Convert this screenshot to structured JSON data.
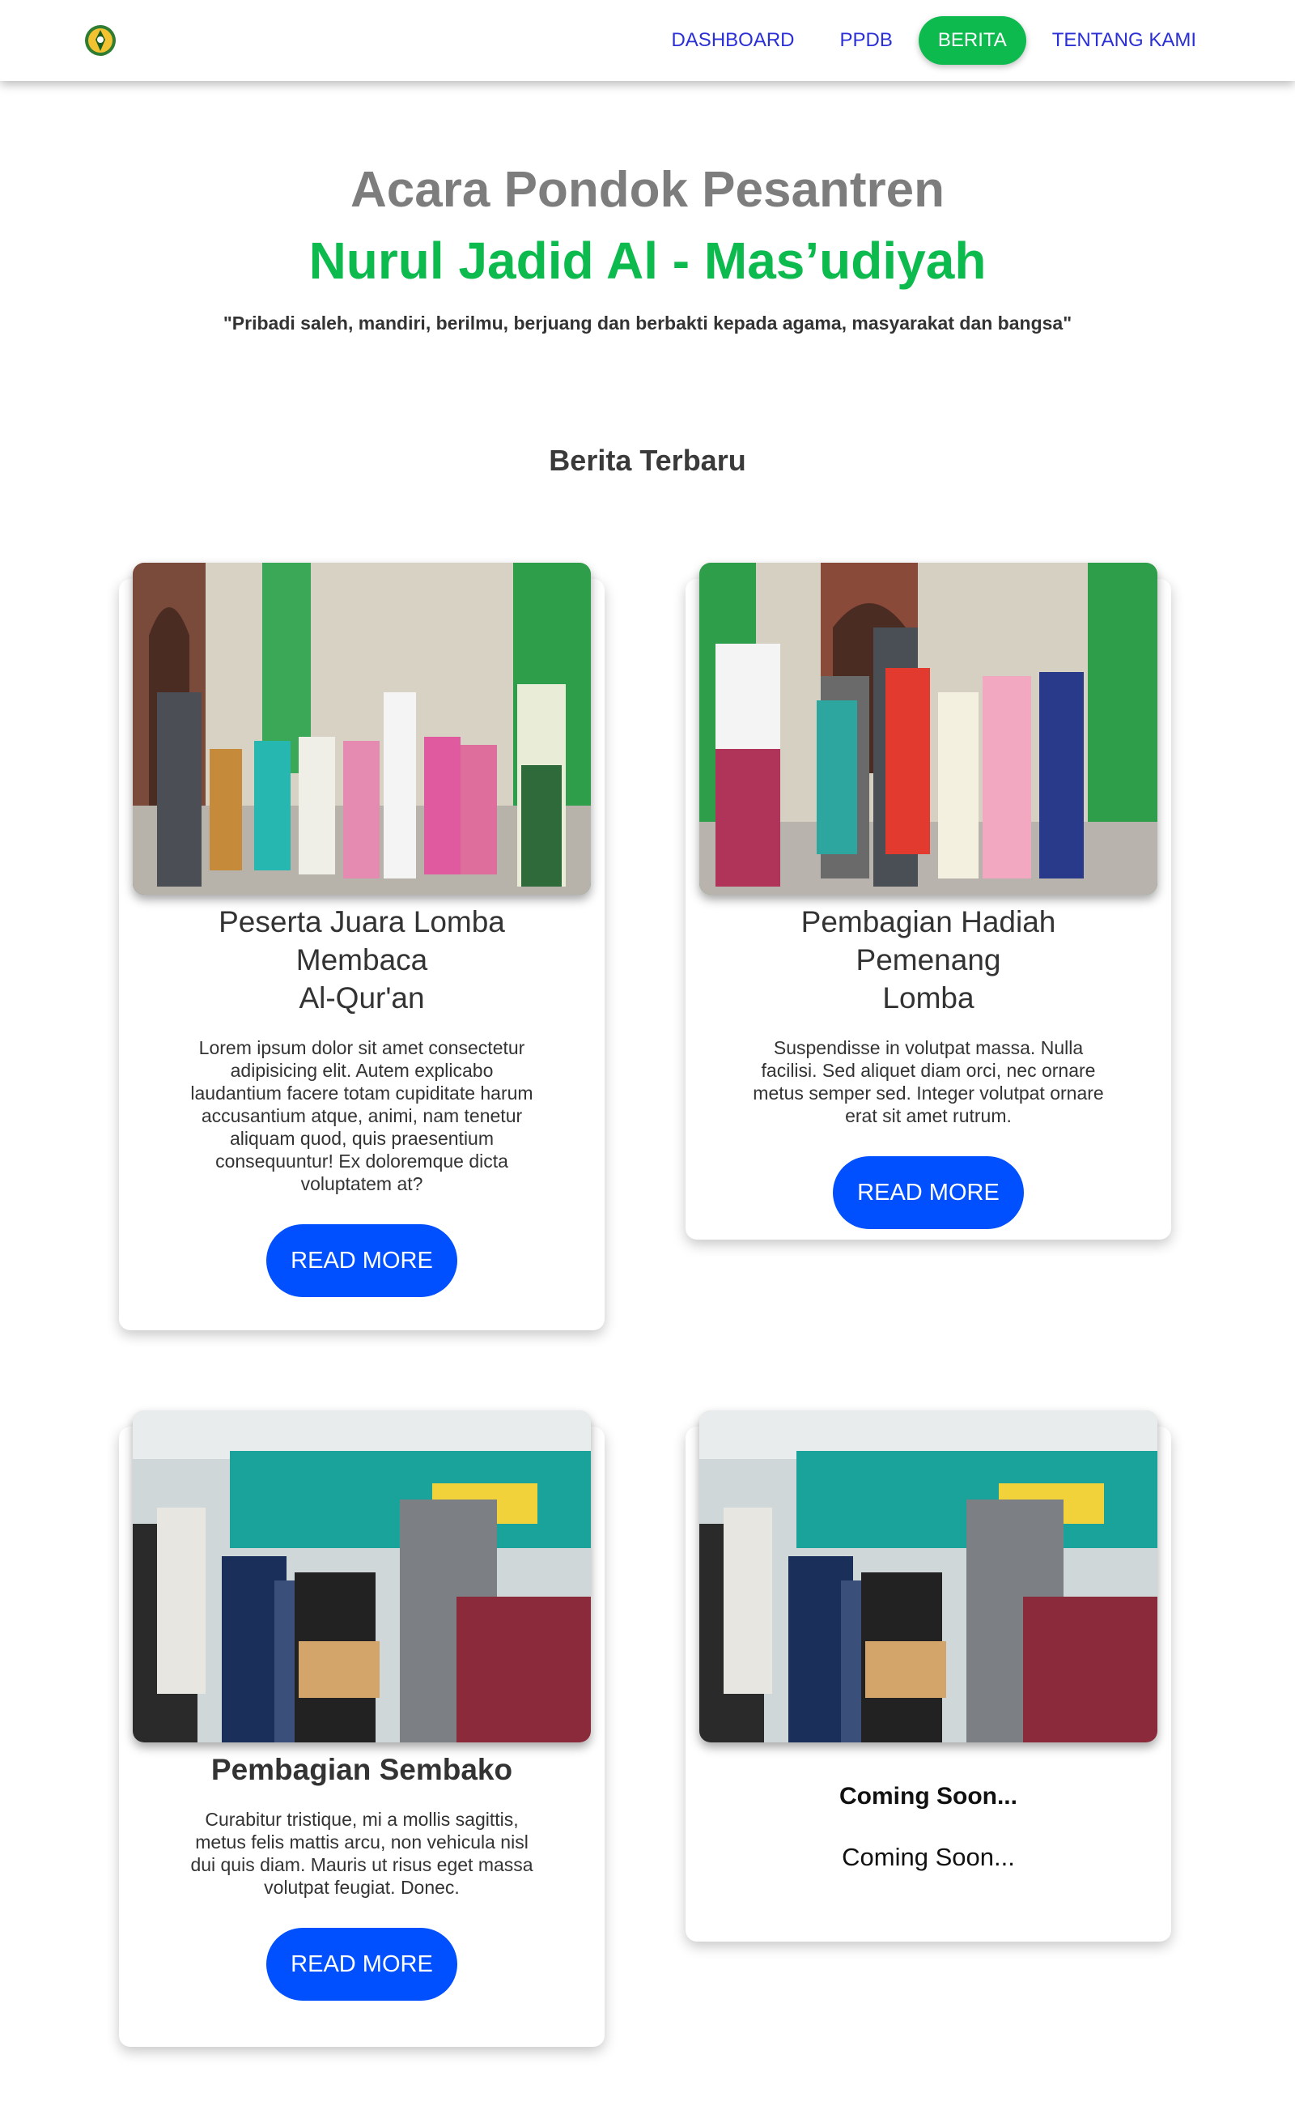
{
  "nav": {
    "items": [
      {
        "label": "DASHBOARD",
        "active": false
      },
      {
        "label": "PPDB",
        "active": false
      },
      {
        "label": "BERITA",
        "active": true
      },
      {
        "label": "TENTANG KAMI",
        "active": false
      }
    ],
    "active_color": "#0dba4d",
    "link_color": "#2b2fd6"
  },
  "hero": {
    "title_line1": "Acara Pondok Pesantren",
    "title_line2": "Nurul Jadid Al - Mas’udiyah",
    "quote": "\"Pribadi saleh, mandiri, berilmu, berjuang dan berbakti kepada agama, masyarakat dan bangsa\""
  },
  "section_title": "Berita Terbaru",
  "cards": [
    {
      "title": "Peserta Juara Lomba\nMembaca\nAl-Qur'an",
      "text": "Lorem ipsum dolor sit amet consectetur\nadipisicing elit. Autem explicabo\nlaudantium facere totam cupiditate harum\naccusantium atque, animi, nam tenetur\naliquam quod, quis praesentium\nconsequuntur! Ex doloremque dicta\nvoluptatem at?",
      "button": "READ MORE"
    },
    {
      "title": "Pembagian Hadiah Pemenang\nLomba",
      "text": "Suspendisse in volutpat massa. Nulla\nfacilisi. Sed aliquet diam orci, nec ornare\nmetus semper sed. Integer volutpat ornare\nerat sit amet rutrum.",
      "button": "READ MORE"
    },
    {
      "title": "Pembagian Sembako",
      "text": "Curabitur tristique, mi a mollis sagittis,\nmetus felis mattis arcu, non vehicula nisl\ndui quis diam. Mauris ut risus eget massa\nvolutpat feugiat. Donec.",
      "button": "READ MORE"
    },
    {
      "title": "Coming Soon...",
      "text": "Coming Soon..."
    }
  ],
  "colors": {
    "button": "#0050ff",
    "accent_green": "#0dba4d",
    "title_gray": "#7d7d7d"
  }
}
